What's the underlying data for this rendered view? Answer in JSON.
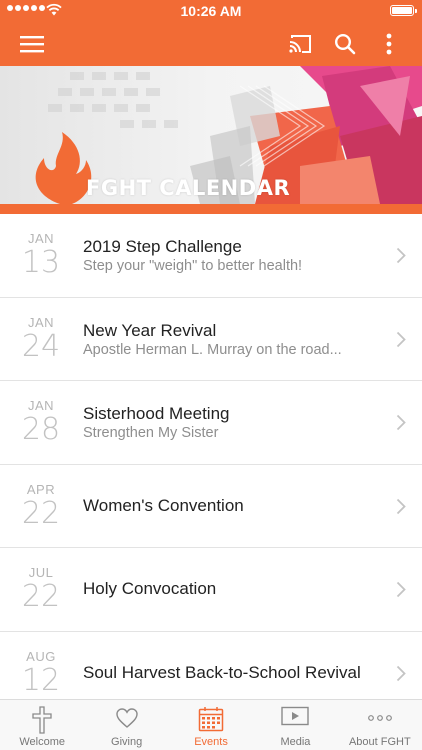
{
  "status_bar": {
    "time": "10:26 AM"
  },
  "app_bar": {
    "menu_icon": "hamburger-menu-icon",
    "cast_icon": "cast-icon",
    "search_icon": "search-icon",
    "more_icon": "more-vertical-icon",
    "accent_color": "#f26b35"
  },
  "banner": {
    "title": "FGHT CALENDAR"
  },
  "events": [
    {
      "month": "JAN",
      "day": "13",
      "title": "2019 Step Challenge",
      "subtitle": "Step your \"weigh\" to better health!"
    },
    {
      "month": "JAN",
      "day": "24",
      "title": "New Year Revival",
      "subtitle": "Apostle Herman L. Murray on the road..."
    },
    {
      "month": "JAN",
      "day": "28",
      "title": "Sisterhood Meeting",
      "subtitle": "Strengthen My Sister"
    },
    {
      "month": "APR",
      "day": "22",
      "title": "Women's Convention",
      "subtitle": ""
    },
    {
      "month": "JUL",
      "day": "22",
      "title": "Holy Convocation",
      "subtitle": ""
    },
    {
      "month": "AUG",
      "day": "12",
      "title": "Soul Harvest Back-to-School Revival",
      "subtitle": ""
    }
  ],
  "tabs": [
    {
      "label": "Welcome",
      "icon": "cross-icon",
      "active": false
    },
    {
      "label": "Giving",
      "icon": "heart-icon",
      "active": false
    },
    {
      "label": "Events",
      "icon": "calendar-icon",
      "active": true
    },
    {
      "label": "Media",
      "icon": "play-icon",
      "active": false
    },
    {
      "label": "About FGHT",
      "icon": "more-horizontal-icon",
      "active": false
    }
  ]
}
